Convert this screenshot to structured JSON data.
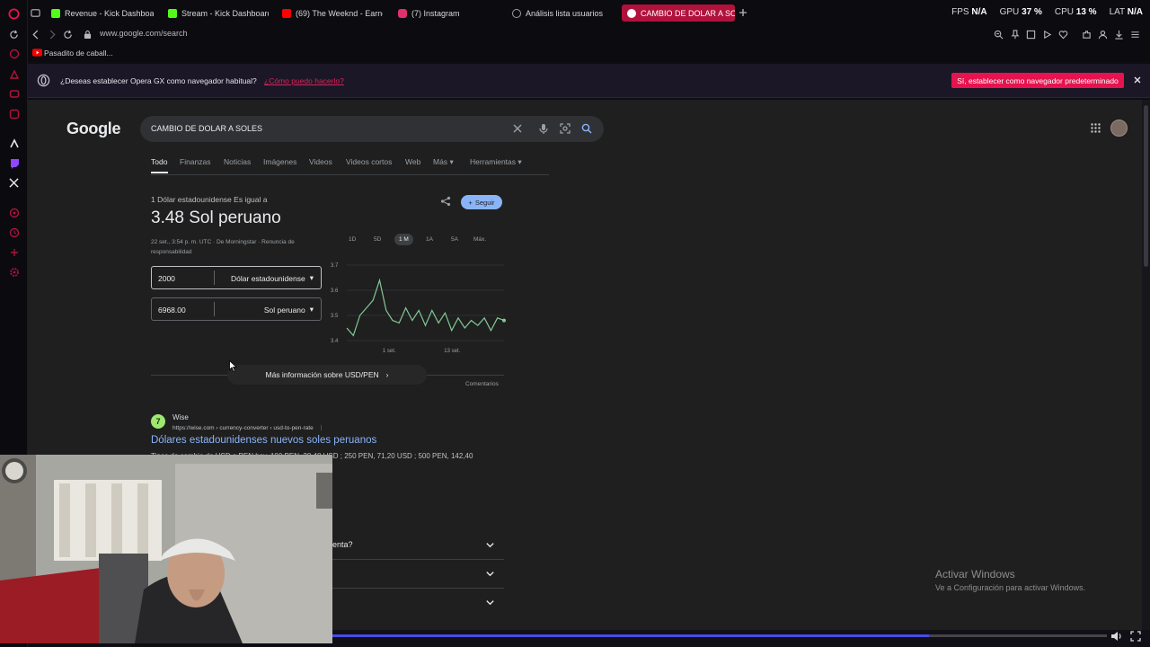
{
  "tabs": [
    {
      "label": "Revenue - Kick Dashboard",
      "fav_color": "#53fc18"
    },
    {
      "label": "Stream - Kick Dashboard",
      "fav_color": "#53fc18"
    },
    {
      "label": "(69) The Weeknd - Earne",
      "fav_color": "#ff0000"
    },
    {
      "label": "(7) Instagram",
      "fav_color": "#e1306c"
    },
    {
      "label": "Análisis lista usuarios",
      "fav_color": "#9aa0a6"
    },
    {
      "label": "CAMBIO DE DOLAR A SO",
      "fav_color": "#ffffff"
    }
  ],
  "hud": {
    "fps_label": "FPS",
    "fps_value": "N/A",
    "gpu_label": "GPU",
    "gpu_value": "37 %",
    "cpu_label": "CPU",
    "cpu_value": "13 %",
    "lat_label": "LAT",
    "lat_value": "N/A"
  },
  "address": {
    "url": "www.google.com/search"
  },
  "bookmarks": {
    "item": "Pasadito de caball..."
  },
  "banner": {
    "text": "¿Deseas establecer Opera GX como navegador habitual?",
    "link": "¿Cómo puedo hacerlo?",
    "button": "Sí, establecer como navegador predeterminado"
  },
  "google": {
    "logo": "Google",
    "query": "CAMBIO DE DOLAR A SOLES",
    "nav": [
      "Todo",
      "Finanzas",
      "Noticias",
      "Imágenes",
      "Videos",
      "Videos cortos",
      "Web",
      "Más",
      "Herramientas"
    ]
  },
  "converter": {
    "header": "1 Dólar estadounidense Es igual a",
    "rate": "3.48 Sol peruano",
    "meta": "22 set., 3:54 p. m. UTC · De Morningstar · Renuncia de responsabilidad",
    "follow": "Seguir",
    "from_value": "2000",
    "from_currency": "Dólar estadounidense",
    "to_value": "6968.00",
    "to_currency": "Sol peruano",
    "ranges": [
      "1D",
      "5D",
      "1 M",
      "1A",
      "5A",
      "Máx."
    ],
    "more_info": "Más información sobre USD/PEN",
    "comments": "Comentarios"
  },
  "chart_data": {
    "type": "line",
    "title": "",
    "xlabel": "",
    "ylabel": "",
    "ylim": [
      3.4,
      3.7
    ],
    "y_ticks": [
      "3.7",
      "3.6",
      "3.5",
      "3.4"
    ],
    "x_ticks": [
      "1 set.",
      "13 set."
    ],
    "line_color": "#81c995",
    "series": [
      {
        "values": [
          3.45,
          3.42,
          3.5,
          3.53,
          3.56,
          3.64,
          3.52,
          3.48,
          3.47,
          3.53,
          3.48,
          3.52,
          3.46,
          3.52,
          3.47,
          3.51,
          3.44,
          3.49,
          3.45,
          3.48,
          3.46,
          3.49,
          3.44,
          3.49,
          3.48
        ]
      }
    ]
  },
  "result": {
    "fav_letter": "7",
    "site": "Wise",
    "url": "https://wise.com › currency-converter › usd-to-pen-rate",
    "title": "Dólares estadounidenses nuevos soles peruanos",
    "snippet": "Tipos de cambio de USD a PEN hoy. 100 PEN, 28,48 USD ; 250 PEN, 71,20 USD ; 500 PEN, 142,40"
  },
  "paa": {
    "question_fragment": "enta?"
  },
  "windows": {
    "title": "Activar Windows",
    "subtitle": "Ve a Configuración para activar Windows."
  },
  "video": {
    "progress": 0.77
  }
}
